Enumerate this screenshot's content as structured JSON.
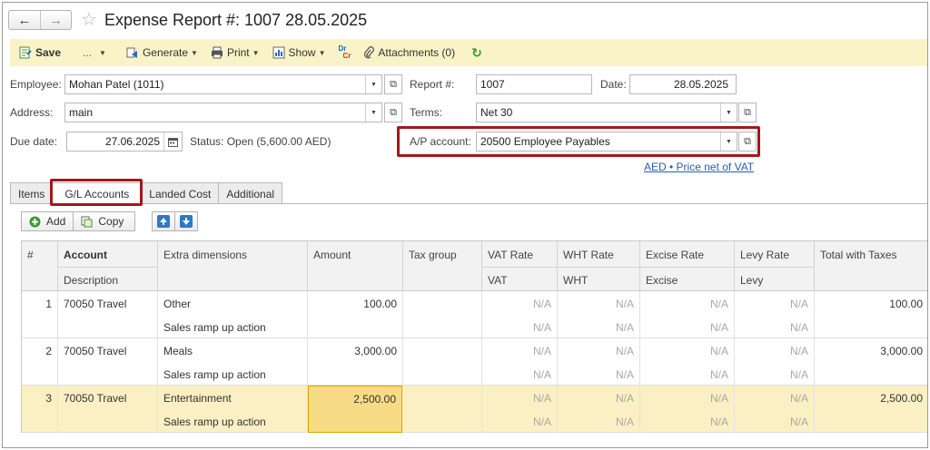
{
  "window": {
    "title": "Expense Report #: 1007 28.05.2025",
    "back_icon": "arrow-left-icon",
    "forward_icon": "arrow-right-icon",
    "favorite_icon": "star-icon"
  },
  "toolbar": {
    "save": "Save",
    "more": "...",
    "generate": "Generate",
    "print": "Print",
    "show": "Show",
    "dr": "Dr",
    "cr": "Cr",
    "attachments": "Attachments (0)"
  },
  "form": {
    "employee_label": "Employee:",
    "employee_value": "Mohan Patel (1011)",
    "report_label": "Report #:",
    "report_value": "1007",
    "date_label": "Date:",
    "date_value": "28.05.2025",
    "address_label": "Address:",
    "address_value": "main",
    "terms_label": "Terms:",
    "terms_value": "Net 30",
    "due_label": "Due date:",
    "due_value": "27.06.2025",
    "status_label": "Status:",
    "status_value": "Open (5,600.00 AED)",
    "ap_label": "A/P account:",
    "ap_value": "20500 Employee Payables",
    "currency_link": "AED • Price net of VAT"
  },
  "tabs": [
    "Items",
    "G/L Accounts",
    "Landed Cost",
    "Additional"
  ],
  "active_tab": 1,
  "table_toolbar": {
    "add": "Add",
    "copy": "Copy"
  },
  "table": {
    "headers": {
      "num": "#",
      "account": "Account",
      "description": "Description",
      "extra": "Extra dimensions",
      "amount": "Amount",
      "tax_group": "Tax group",
      "vat_rate": "VAT Rate",
      "vat": "VAT",
      "wht_rate": "WHT Rate",
      "wht": "WHT",
      "excise_rate": "Excise Rate",
      "excise": "Excise",
      "levy_rate": "Levy Rate",
      "levy": "Levy",
      "total": "Total with Taxes"
    },
    "rows": [
      {
        "num": "1",
        "account": "70050 Travel",
        "extra1": "Other",
        "extra2": "Sales ramp up action",
        "amount": "100.00",
        "na": "N/A",
        "total": "100.00"
      },
      {
        "num": "2",
        "account": "70050 Travel",
        "extra1": "Meals",
        "extra2": "Sales ramp up action",
        "amount": "3,000.00",
        "na": "N/A",
        "total": "3,000.00"
      },
      {
        "num": "3",
        "account": "70050 Travel",
        "extra1": "Entertainment",
        "extra2": "Sales ramp up action",
        "amount": "2,500.00",
        "na": "N/A",
        "total": "2,500.00"
      }
    ],
    "selected_row": 2
  }
}
